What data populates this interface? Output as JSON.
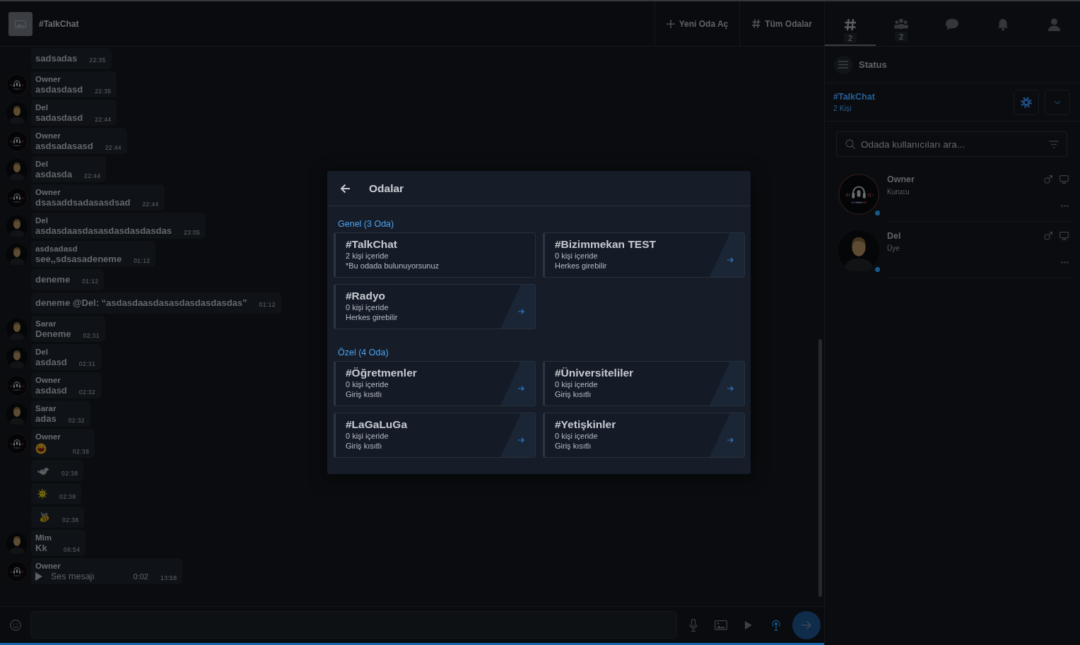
{
  "topbar": {
    "channel": "#TalkChat",
    "actions": [
      "Yeni Oda Aç",
      "Tüm Odalar"
    ]
  },
  "messages": [
    {
      "kind": "text",
      "text": "sadsadas",
      "time": "22:35"
    },
    {
      "kind": "text",
      "avatar": {
        "kind": "logo"
      },
      "sender": "Owner",
      "text": "asdasdasd",
      "time": "22:35"
    },
    {
      "kind": "text",
      "avatar": {
        "kind": "person"
      },
      "sender": "Del",
      "text": "sadasdasd",
      "time": "22:44"
    },
    {
      "kind": "text",
      "avatar": {
        "kind": "logo"
      },
      "sender": "Owner",
      "text": "asdsadasasd",
      "time": "22:44"
    },
    {
      "kind": "text",
      "avatar": {
        "kind": "person"
      },
      "sender": "Del",
      "text": "asdasda",
      "time": "22:44"
    },
    {
      "kind": "text",
      "avatar": {
        "kind": "logo"
      },
      "sender": "Owner",
      "text": "dsasaddsadasasdsad",
      "time": "22:44"
    },
    {
      "kind": "text",
      "avatar": {
        "kind": "person"
      },
      "sender": "Del",
      "text": "asdasdaasdasasdasdasdasdas",
      "time": "23:05"
    },
    {
      "kind": "text",
      "avatar": {
        "kind": "person"
      },
      "sender": "asdsadasd",
      "text": "see,,sdsasadeneme",
      "time": "01:12"
    },
    {
      "kind": "text",
      "text": "deneme",
      "time": "01:12"
    },
    {
      "kind": "text",
      "text": "deneme @Del: “asdasdaasdasasdasdasdasdas”",
      "time": "01:12"
    },
    {
      "kind": "text",
      "avatar": {
        "kind": "person"
      },
      "sender": "Sarar",
      "text": "Deneme",
      "time": "02:31"
    },
    {
      "kind": "text",
      "avatar": {
        "kind": "person"
      },
      "sender": "Del",
      "text": "asdasd",
      "time": "02:31"
    },
    {
      "kind": "text",
      "avatar": {
        "kind": "logo"
      },
      "sender": "Owner",
      "text": "asdasd",
      "time": "02:32"
    },
    {
      "kind": "text",
      "avatar": {
        "kind": "person"
      },
      "sender": "Sarar",
      "text": "adas",
      "time": "02:32"
    },
    {
      "kind": "sticker",
      "avatar": {
        "kind": "logo"
      },
      "sender": "Owner",
      "time": "02:38"
    },
    {
      "kind": "sticker",
      "time": "02:38"
    },
    {
      "kind": "sticker",
      "time": "02:38"
    },
    {
      "kind": "sticker",
      "time": "02:38"
    },
    {
      "kind": "text",
      "avatar": {
        "kind": "person"
      },
      "sender": "Mlm",
      "text": "Kk",
      "time": "06:54"
    },
    {
      "kind": "voice",
      "avatar": {
        "kind": "logo"
      },
      "sender": "Owner",
      "text": "Ses mesajı",
      "duration": "0:02",
      "time": "13:58"
    }
  ],
  "sidebar": {
    "tabs": [
      {
        "badge": "2",
        "selected": true
      },
      {
        "badge": "2",
        "selected": false
      },
      {
        "selected": false
      },
      {
        "selected": false
      },
      {
        "selected": false
      }
    ],
    "panel_title": "Status",
    "room": {
      "name": "#TalkChat",
      "count": "2 Kişi"
    },
    "search": {
      "placeholder": "Odada kullanıcıları ara..."
    },
    "users": [
      {
        "name": "Owner",
        "role": "Kurucu",
        "avatar": {
          "kind": "logo"
        },
        "online": true
      },
      {
        "name": "Del",
        "role": "Üye",
        "avatar": {
          "kind": "person"
        },
        "online": true
      }
    ]
  },
  "rooms_dialog": {
    "title": "Odalar",
    "sections": [
      {
        "title": "Genel (3 Oda)",
        "rooms": [
          {
            "name": "#TalkChat",
            "occupancy": "2 kişi içeride",
            "access": "*Bu odada bulunuyorsunuz",
            "current": true
          },
          {
            "name": "#Bizimmekan TEST",
            "occupancy": "0 kişi içeride",
            "access": "Herkes girebilir",
            "current": false
          },
          {
            "name": "#Radyo",
            "occupancy": "0 kişi içeride",
            "access": "Herkes girebilir",
            "current": false
          }
        ]
      },
      {
        "title": "Özel (4 Oda)",
        "rooms": [
          {
            "name": "#Öğretmenler",
            "occupancy": "0 kişi içeride",
            "access": "Giriş kısıtlı",
            "current": false
          },
          {
            "name": "#Üniversiteliler",
            "occupancy": "0 kişi içeride",
            "access": "Giriş kısıtlı",
            "current": false
          },
          {
            "name": "#LaGaLuGa",
            "occupancy": "0 kişi içeride",
            "access": "Giriş kısıtlı",
            "current": false
          },
          {
            "name": "#Yetişkinler",
            "occupancy": "0 kişi içeride",
            "access": "Giriş kısıtlı",
            "current": false
          }
        ]
      }
    ]
  }
}
